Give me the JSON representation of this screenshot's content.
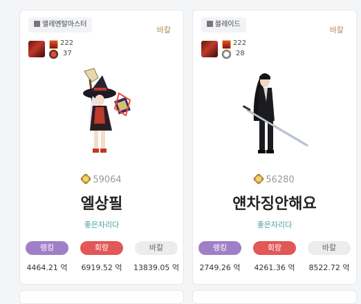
{
  "cards": [
    {
      "job": "엘레멘탈마스터",
      "server": "바칼",
      "stat1": "222",
      "stat2": "37",
      "fame": "59064",
      "name": "엘상필",
      "guild": "좋은자리다",
      "buttons": [
        "랭킹",
        "회랑",
        "바칼"
      ],
      "values": [
        "4464.21 억",
        "6919.52 억",
        "13839.05 억"
      ]
    },
    {
      "job": "블레이드",
      "server": "바칼",
      "stat1": "222",
      "stat2": "28",
      "fame": "56280",
      "name": "얜차징안해요",
      "guild": "좋은자리다",
      "buttons": [
        "랭킹",
        "회랑",
        "바칼"
      ],
      "values": [
        "2749.26 억",
        "4261.36 억",
        "8522.72 억"
      ]
    }
  ]
}
